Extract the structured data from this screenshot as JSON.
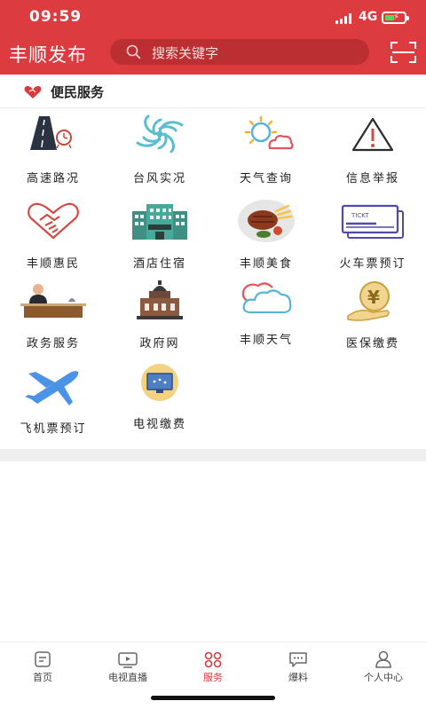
{
  "status_bar": {
    "time": "09:59",
    "network": "4G"
  },
  "header": {
    "title": "丰顺发布",
    "search_placeholder": "搜索关键字"
  },
  "section": {
    "title": "便民服务",
    "items": [
      {
        "label": "高速路况",
        "icon": "highway-icon"
      },
      {
        "label": "台风实况",
        "icon": "typhoon-icon"
      },
      {
        "label": "天气查询",
        "icon": "weather-sun-icon"
      },
      {
        "label": "信息举报",
        "icon": "warning-icon"
      },
      {
        "label": "丰顺惠民",
        "icon": "handshake-icon"
      },
      {
        "label": "酒店住宿",
        "icon": "hotel-icon"
      },
      {
        "label": "丰顺美食",
        "icon": "steak-icon"
      },
      {
        "label": "火车票预订",
        "icon": "train-ticket-icon",
        "ticket_text": "TICKT"
      },
      {
        "label": "政务服务",
        "icon": "government-service-icon"
      },
      {
        "label": "政府网",
        "icon": "government-building-icon"
      },
      {
        "label": "丰顺天气",
        "icon": "cloud-icon"
      },
      {
        "label": "医保缴费",
        "icon": "medical-insurance-icon",
        "symbol": "¥"
      },
      {
        "label": "飞机票预订",
        "icon": "airplane-icon"
      },
      {
        "label": "电视缴费",
        "icon": "tv-payment-icon"
      }
    ]
  },
  "tabbar": {
    "tabs": [
      {
        "label": "首页",
        "icon": "home-icon"
      },
      {
        "label": "电视直播",
        "icon": "tv-live-icon"
      },
      {
        "label": "服务",
        "icon": "service-icon",
        "active": true
      },
      {
        "label": "爆料",
        "icon": "chat-icon"
      },
      {
        "label": "个人中心",
        "icon": "user-icon"
      }
    ]
  },
  "colors": {
    "brand": "#dc3c40",
    "brand_dark": "#bb2f33",
    "active_tab": "#d83b3e",
    "divider": "#eeeeee"
  }
}
